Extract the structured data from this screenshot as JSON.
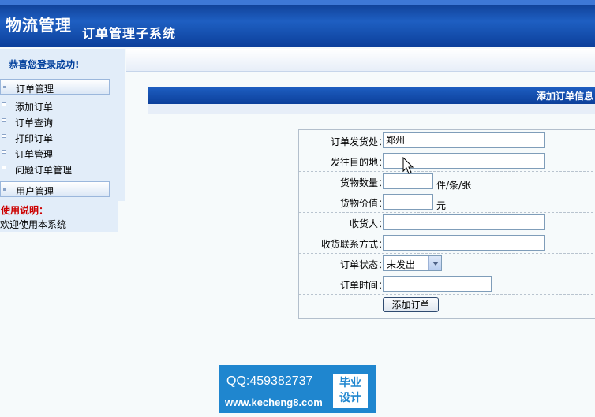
{
  "header": {
    "logo": "物流管理",
    "subtitle": "订单管理子系统"
  },
  "sidebar": {
    "welcome": "恭喜您登录成功!",
    "groups": [
      {
        "label": "订单管理"
      },
      {
        "label": "用户管理"
      }
    ],
    "items": [
      {
        "label": "添加订单"
      },
      {
        "label": "订单查询"
      },
      {
        "label": "打印订单"
      },
      {
        "label": "订单管理"
      },
      {
        "label": "问题订单管理"
      }
    ],
    "help": {
      "title": "使用说明：",
      "text": "欢迎使用本系统"
    }
  },
  "main": {
    "section_title": "添加订单信息"
  },
  "form": {
    "origin": {
      "label": "订单发货处：",
      "value": "郑州"
    },
    "destination": {
      "label": "发往目的地：",
      "value": ""
    },
    "quantity": {
      "label": "货物数量：",
      "value": "",
      "unit": "件/条/张"
    },
    "price": {
      "label": "货物价值：",
      "value": "",
      "unit": "元"
    },
    "receiver": {
      "label": "收货人：",
      "value": ""
    },
    "contact": {
      "label": "收货联系方式：",
      "value": ""
    },
    "status": {
      "label": "订单状态：",
      "selected": "未发出"
    },
    "time": {
      "label": "订单时间：",
      "value": ""
    },
    "submit_label": "添加订单"
  },
  "watermark": {
    "qq": "QQ:459382737",
    "url": "www.kecheng8.com",
    "badge_line1": "毕业",
    "badge_line2": "设计"
  }
}
